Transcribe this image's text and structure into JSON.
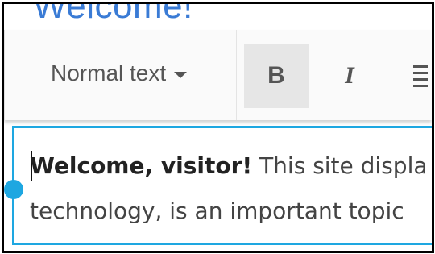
{
  "page": {
    "heading": "Welcome!"
  },
  "toolbar": {
    "style_select": "Normal text",
    "bold_label": "B",
    "italic_label": "I",
    "align_icon": "align-left-icon"
  },
  "editor": {
    "line1_bold": "Welcome, visitor!",
    "line1_rest": " This site displa",
    "line2": "technology, is an important topic"
  },
  "colors": {
    "accent": "#1ea7e1",
    "heading": "#3a7bd5",
    "active_button_bg": "#e6e6e6"
  }
}
